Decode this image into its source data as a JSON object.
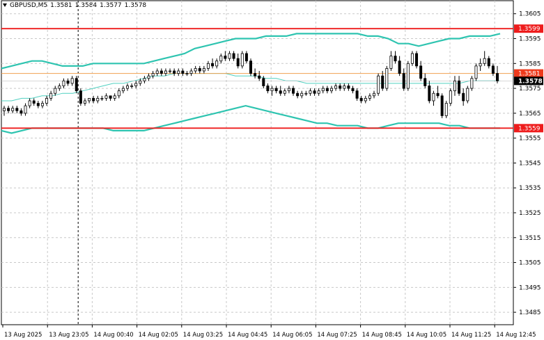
{
  "header": {
    "symbol": "GBPUSD,M5",
    "open": "1.3581",
    "high": "1.3584",
    "low": "1.3577",
    "close": "1.3578"
  },
  "colors": {
    "background": "#ffffff",
    "candle": "#000000",
    "grid": "#c8c8c8",
    "bands": "#2ec4b0",
    "sma": "#4fd0c0",
    "level_line": "#ee1c1c",
    "bid_line": "#f0a050",
    "current_label_bg": "#000000"
  },
  "chart_data": {
    "type": "candlestick",
    "title": "GBPUSD,M5",
    "ylim": [
      1.348,
      1.3608
    ],
    "y_ticks": [
      "1.3605",
      "1.3595",
      "1.3585",
      "1.3575",
      "1.3565",
      "1.3555",
      "1.3545",
      "1.3535",
      "1.3525",
      "1.3515",
      "1.3505",
      "1.3495",
      "1.3485"
    ],
    "x_ticks": [
      "13 Aug 2025",
      "13 Aug 23:05",
      "14 Aug 00:40",
      "14 Aug 02:05",
      "14 Aug 03:25",
      "14 Aug 04:45",
      "14 Aug 06:05",
      "14 Aug 07:25",
      "14 Aug 08:45",
      "14 Aug 10:05",
      "14 Aug 11:25",
      "14 Aug 12:45"
    ],
    "grid": true,
    "horizontal_levels": [
      {
        "value": 1.3599,
        "label": "1.3599",
        "color": "#ee1c1c"
      },
      {
        "value": 1.3559,
        "label": "1.3559",
        "color": "#ee1c1c"
      }
    ],
    "bid_line": {
      "value": 1.3581,
      "label": "1.3581"
    },
    "current_price": {
      "value": 1.3578,
      "label": "1.3578"
    },
    "vertical_marker": "13 Aug 23:05",
    "series": [
      {
        "kind": "ohlc",
        "points": [
          [
            1.3566,
            1.3568,
            1.3564,
            1.3567
          ],
          [
            1.3567,
            1.3568,
            1.3565,
            1.3566
          ],
          [
            1.3566,
            1.3568,
            1.3565,
            1.3567
          ],
          [
            1.3567,
            1.3568,
            1.3565,
            1.3566
          ],
          [
            1.3566,
            1.3567,
            1.3564,
            1.3565
          ],
          [
            1.3565,
            1.3569,
            1.3564,
            1.3568
          ],
          [
            1.3568,
            1.3571,
            1.3567,
            1.357
          ],
          [
            1.357,
            1.3571,
            1.3568,
            1.3569
          ],
          [
            1.3569,
            1.357,
            1.3567,
            1.3568
          ],
          [
            1.3568,
            1.357,
            1.3567,
            1.3569
          ],
          [
            1.3569,
            1.3572,
            1.3568,
            1.3571
          ],
          [
            1.3571,
            1.3574,
            1.357,
            1.3573
          ],
          [
            1.3573,
            1.3576,
            1.3572,
            1.3575
          ],
          [
            1.3575,
            1.3577,
            1.3574,
            1.3576
          ],
          [
            1.3576,
            1.3579,
            1.3575,
            1.3578
          ],
          [
            1.3578,
            1.3579,
            1.3576,
            1.3577
          ],
          [
            1.3577,
            1.358,
            1.3576,
            1.3579
          ],
          [
            1.3579,
            1.358,
            1.3573,
            1.3574
          ],
          [
            1.3574,
            1.3575,
            1.3568,
            1.3569
          ],
          [
            1.3569,
            1.3571,
            1.3568,
            1.357
          ],
          [
            1.357,
            1.3571,
            1.3569,
            1.3571
          ],
          [
            1.3571,
            1.3572,
            1.3569,
            1.357
          ],
          [
            1.357,
            1.3572,
            1.3569,
            1.3571
          ],
          [
            1.3571,
            1.3572,
            1.357,
            1.3571
          ],
          [
            1.3571,
            1.3573,
            1.357,
            1.3572
          ],
          [
            1.3572,
            1.3572,
            1.357,
            1.3571
          ],
          [
            1.3571,
            1.3573,
            1.357,
            1.3572
          ],
          [
            1.3572,
            1.3575,
            1.3571,
            1.3574
          ],
          [
            1.3574,
            1.3576,
            1.3573,
            1.3575
          ],
          [
            1.3575,
            1.3577,
            1.3574,
            1.3576
          ],
          [
            1.3576,
            1.3577,
            1.3575,
            1.3576
          ],
          [
            1.3576,
            1.3578,
            1.3575,
            1.3577
          ],
          [
            1.3577,
            1.3579,
            1.3576,
            1.3578
          ],
          [
            1.3578,
            1.358,
            1.3577,
            1.3579
          ],
          [
            1.3579,
            1.3581,
            1.3578,
            1.358
          ],
          [
            1.358,
            1.3582,
            1.3579,
            1.3581
          ],
          [
            1.3581,
            1.3583,
            1.358,
            1.3582
          ],
          [
            1.3582,
            1.3583,
            1.358,
            1.3581
          ],
          [
            1.3581,
            1.3583,
            1.358,
            1.3582
          ],
          [
            1.3582,
            1.3583,
            1.3581,
            1.3582
          ],
          [
            1.3582,
            1.3583,
            1.358,
            1.3581
          ],
          [
            1.3581,
            1.3583,
            1.358,
            1.3582
          ],
          [
            1.3582,
            1.3583,
            1.358,
            1.3581
          ],
          [
            1.3581,
            1.3582,
            1.358,
            1.3581
          ],
          [
            1.3581,
            1.3583,
            1.358,
            1.3582
          ],
          [
            1.3582,
            1.3584,
            1.3581,
            1.3583
          ],
          [
            1.3583,
            1.3584,
            1.3581,
            1.3582
          ],
          [
            1.3582,
            1.3584,
            1.3581,
            1.3583
          ],
          [
            1.3583,
            1.3586,
            1.3582,
            1.3585
          ],
          [
            1.3585,
            1.3587,
            1.3583,
            1.3584
          ],
          [
            1.3584,
            1.3587,
            1.3583,
            1.3586
          ],
          [
            1.3586,
            1.3589,
            1.3585,
            1.3588
          ],
          [
            1.3588,
            1.359,
            1.3586,
            1.3587
          ],
          [
            1.3587,
            1.359,
            1.3586,
            1.3589
          ],
          [
            1.3589,
            1.359,
            1.3586,
            1.3587
          ],
          [
            1.3587,
            1.3589,
            1.3583,
            1.3584
          ],
          [
            1.3584,
            1.359,
            1.3583,
            1.3589
          ],
          [
            1.3589,
            1.359,
            1.3585,
            1.3586
          ],
          [
            1.3586,
            1.3587,
            1.358,
            1.3581
          ],
          [
            1.3581,
            1.3583,
            1.3579,
            1.358
          ],
          [
            1.358,
            1.3582,
            1.3578,
            1.3579
          ],
          [
            1.3579,
            1.358,
            1.3575,
            1.3576
          ],
          [
            1.3576,
            1.3577,
            1.3573,
            1.3574
          ],
          [
            1.3574,
            1.3576,
            1.3572,
            1.3575
          ],
          [
            1.3575,
            1.3576,
            1.3573,
            1.3574
          ],
          [
            1.3574,
            1.3576,
            1.3572,
            1.3573
          ],
          [
            1.3573,
            1.3575,
            1.3572,
            1.3574
          ],
          [
            1.3574,
            1.3576,
            1.3573,
            1.3575
          ],
          [
            1.3575,
            1.3576,
            1.3572,
            1.3573
          ],
          [
            1.3573,
            1.3574,
            1.3571,
            1.3572
          ],
          [
            1.3572,
            1.3574,
            1.3571,
            1.3573
          ],
          [
            1.3573,
            1.3574,
            1.3572,
            1.3573
          ],
          [
            1.3573,
            1.3575,
            1.3572,
            1.3574
          ],
          [
            1.3574,
            1.3575,
            1.3572,
            1.3573
          ],
          [
            1.3573,
            1.3575,
            1.3572,
            1.3574
          ],
          [
            1.3574,
            1.3576,
            1.3573,
            1.3575
          ],
          [
            1.3575,
            1.3576,
            1.3573,
            1.3574
          ],
          [
            1.3574,
            1.3576,
            1.3573,
            1.3575
          ],
          [
            1.3575,
            1.3577,
            1.3574,
            1.3576
          ],
          [
            1.3576,
            1.3577,
            1.3574,
            1.3575
          ],
          [
            1.3575,
            1.3577,
            1.3574,
            1.3576
          ],
          [
            1.3576,
            1.3577,
            1.3574,
            1.3575
          ],
          [
            1.3575,
            1.3576,
            1.3573,
            1.3574
          ],
          [
            1.3574,
            1.3575,
            1.357,
            1.3571
          ],
          [
            1.3571,
            1.3572,
            1.3569,
            1.357
          ],
          [
            1.357,
            1.3572,
            1.3569,
            1.3571
          ],
          [
            1.3571,
            1.3573,
            1.357,
            1.3572
          ],
          [
            1.3572,
            1.3574,
            1.3571,
            1.3573
          ],
          [
            1.3573,
            1.3581,
            1.3572,
            1.358
          ],
          [
            1.358,
            1.3582,
            1.3574,
            1.3575
          ],
          [
            1.3575,
            1.3584,
            1.3574,
            1.3583
          ],
          [
            1.3583,
            1.359,
            1.3582,
            1.3588
          ],
          [
            1.3588,
            1.359,
            1.3585,
            1.3586
          ],
          [
            1.3586,
            1.3588,
            1.358,
            1.3581
          ],
          [
            1.3581,
            1.3583,
            1.3574,
            1.3575
          ],
          [
            1.3575,
            1.3586,
            1.3574,
            1.3585
          ],
          [
            1.3585,
            1.359,
            1.3584,
            1.3589
          ],
          [
            1.3589,
            1.359,
            1.3583,
            1.3584
          ],
          [
            1.3584,
            1.3586,
            1.3578,
            1.3579
          ],
          [
            1.3579,
            1.3581,
            1.3575,
            1.3576
          ],
          [
            1.3576,
            1.3578,
            1.3569,
            1.357
          ],
          [
            1.357,
            1.3574,
            1.3568,
            1.3573
          ],
          [
            1.3573,
            1.3576,
            1.3571,
            1.3572
          ],
          [
            1.3572,
            1.3573,
            1.3563,
            1.3564
          ],
          [
            1.3564,
            1.357,
            1.3563,
            1.3569
          ],
          [
            1.3569,
            1.3575,
            1.3568,
            1.3574
          ],
          [
            1.3574,
            1.358,
            1.3572,
            1.3578
          ],
          [
            1.3578,
            1.358,
            1.3572,
            1.3573
          ],
          [
            1.3573,
            1.3575,
            1.3568,
            1.357
          ],
          [
            1.357,
            1.3576,
            1.3569,
            1.3575
          ],
          [
            1.3575,
            1.358,
            1.3574,
            1.3579
          ],
          [
            1.3579,
            1.3585,
            1.3578,
            1.3584
          ],
          [
            1.3584,
            1.3587,
            1.3582,
            1.3585
          ],
          [
            1.3585,
            1.359,
            1.3584,
            1.3587
          ],
          [
            1.3587,
            1.3588,
            1.3583,
            1.3584
          ],
          [
            1.3584,
            1.3585,
            1.358,
            1.3581
          ],
          [
            1.3581,
            1.3584,
            1.3577,
            1.3578
          ]
        ]
      },
      {
        "name": "",
        "kind": "line",
        "role": "upper_band",
        "values": [
          1.3583,
          1.3584,
          1.3585,
          1.3586,
          1.3586,
          1.3585,
          1.3584,
          1.3584,
          1.3584,
          1.3585,
          1.3585,
          1.3585,
          1.3585,
          1.3585,
          1.3585,
          1.3586,
          1.3587,
          1.3588,
          1.3589,
          1.3591,
          1.3592,
          1.3593,
          1.3594,
          1.3595,
          1.3595,
          1.3595,
          1.3596,
          1.3596,
          1.3596,
          1.3597,
          1.3597,
          1.3597,
          1.3597,
          1.3597,
          1.3597,
          1.3597,
          1.3596,
          1.3596,
          1.3595,
          1.3593,
          1.3593,
          1.3592,
          1.3593,
          1.3594,
          1.3595,
          1.3595,
          1.3596,
          1.3596,
          1.3596,
          1.3597
        ]
      },
      {
        "name": "",
        "kind": "line",
        "role": "middle_band",
        "values": [
          1.357,
          1.357,
          1.3571,
          1.3571,
          1.3572,
          1.3572,
          1.3573,
          1.3573,
          1.3574,
          1.3575,
          1.3576,
          1.3577,
          1.3577,
          1.3578,
          1.3579,
          1.358,
          1.358,
          1.3581,
          1.3581,
          1.3581,
          1.3581,
          1.3581,
          1.3581,
          1.358,
          1.358,
          1.358,
          1.3579,
          1.3579,
          1.3578,
          1.3578,
          1.3577,
          1.3577,
          1.3577,
          1.3577,
          1.3577,
          1.3577,
          1.3577,
          1.3577,
          1.3577,
          1.3577,
          1.3577,
          1.3577,
          1.3577,
          1.3577,
          1.3577,
          1.3577,
          1.3578,
          1.3578,
          1.3578,
          1.3578
        ]
      },
      {
        "name": "",
        "kind": "line",
        "role": "lower_band",
        "values": [
          1.3558,
          1.3557,
          1.3558,
          1.3559,
          1.3559,
          1.3559,
          1.3559,
          1.3559,
          1.3559,
          1.3559,
          1.3559,
          1.3558,
          1.3558,
          1.3558,
          1.3558,
          1.3559,
          1.356,
          1.3561,
          1.3562,
          1.3563,
          1.3564,
          1.3565,
          1.3566,
          1.3567,
          1.3568,
          1.3567,
          1.3566,
          1.3565,
          1.3564,
          1.3563,
          1.3562,
          1.3561,
          1.3561,
          1.356,
          1.356,
          1.356,
          1.3559,
          1.3559,
          1.356,
          1.3561,
          1.3561,
          1.3561,
          1.3561,
          1.3561,
          1.356,
          1.356,
          1.3559,
          1.3559,
          1.3559,
          1.3559
        ]
      }
    ]
  }
}
